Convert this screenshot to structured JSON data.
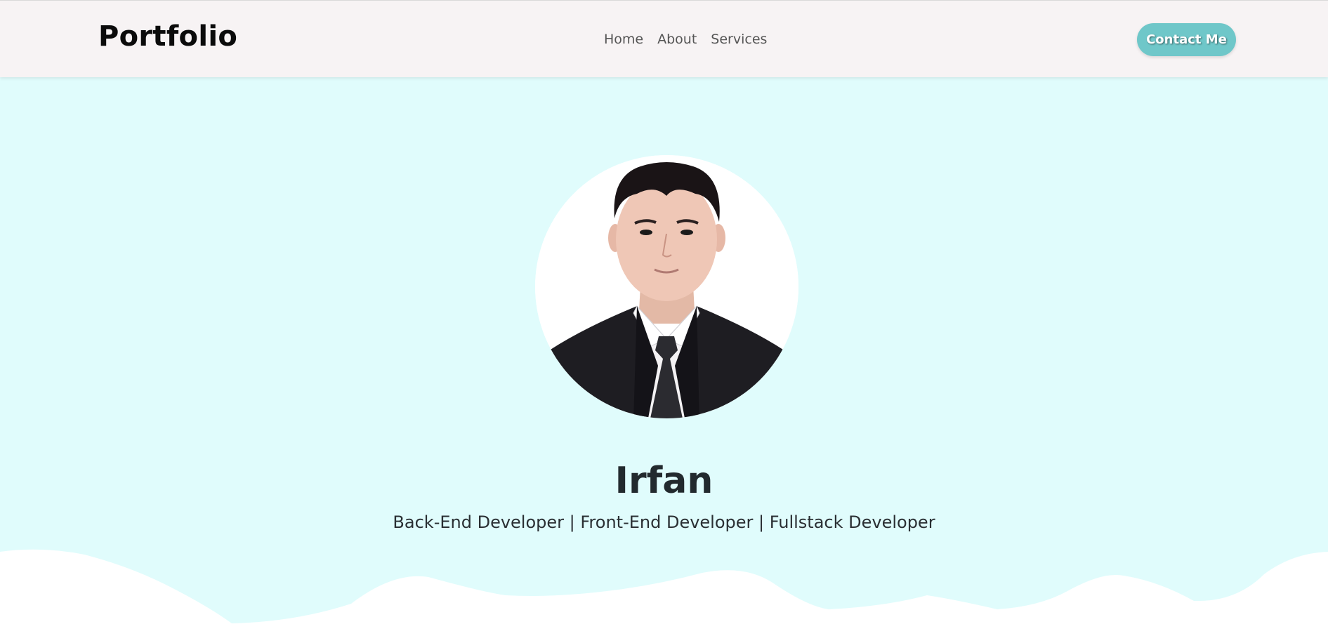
{
  "navbar": {
    "brand": "Portfolio",
    "links": [
      "Home",
      "About",
      "Services"
    ],
    "cta_label": "Contact Me"
  },
  "hero": {
    "name": "Irfan",
    "subtitle": "Back-End Developer | Front-End Developer | Fullstack Developer"
  },
  "colors": {
    "hero_background": "#e0fcfc",
    "navbar_background": "#f7f3f4",
    "accent": "#6fc7c9"
  }
}
